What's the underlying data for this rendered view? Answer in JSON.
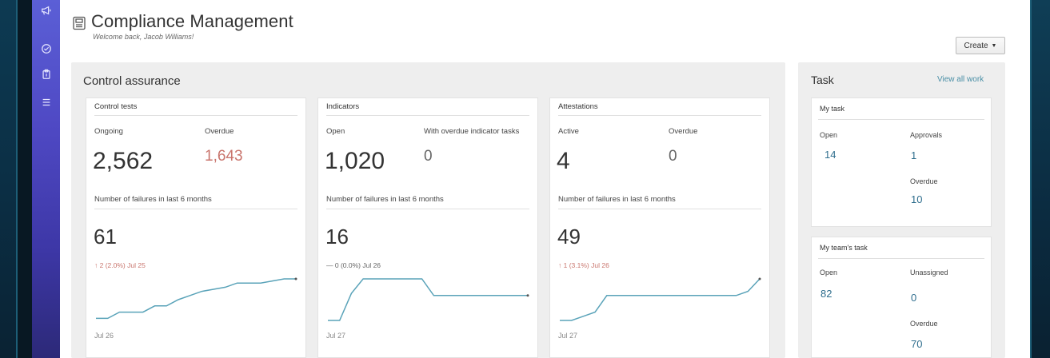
{
  "app": {
    "title": "Compliance Management",
    "welcome": "Welcome back, Jacob Williams!"
  },
  "sidebar": {
    "items": [
      {
        "icon": "megaphone-icon"
      },
      {
        "icon": "check-circle-icon"
      },
      {
        "icon": "clipboard-icon"
      },
      {
        "icon": "list-icon"
      }
    ]
  },
  "toolbar": {
    "create_label": "Create"
  },
  "control_assurance": {
    "title": "Control assurance",
    "control_tests": {
      "title": "Control tests",
      "ongoing_label": "Ongoing",
      "ongoing_value": "2,562",
      "overdue_label": "Overdue",
      "overdue_value": "1,643",
      "failures_label": "Number of failures in last 6 months",
      "failures_value": "61",
      "delta": "2 (2.0%) Jul 25",
      "sparkline": [
        0.05,
        0.05,
        0.2,
        0.2,
        0.2,
        0.35,
        0.35,
        0.5,
        0.6,
        0.7,
        0.75,
        0.8,
        0.9,
        0.9,
        0.9,
        0.95,
        1.0,
        1.0
      ],
      "date": "Jul 26"
    },
    "indicators": {
      "title": "Indicators",
      "open_label": "Open",
      "open_value": "1,020",
      "overdue_label": "With overdue indicator tasks",
      "overdue_value": "0",
      "failures_label": "Number of failures in last 6 months",
      "failures_value": "16",
      "delta": "— 0 (0.0%) Jul 26",
      "sparkline": [
        0.0,
        0.0,
        0.65,
        1.0,
        1.0,
        1.0,
        1.0,
        1.0,
        1.0,
        0.6,
        0.6,
        0.6,
        0.6,
        0.6,
        0.6,
        0.6,
        0.6,
        0.6
      ],
      "date": "Jul 27"
    },
    "attestations": {
      "title": "Attestations",
      "active_label": "Active",
      "active_value": "4",
      "overdue_label": "Overdue",
      "overdue_value": "0",
      "failures_label": "Number of failures in last 6 months",
      "failures_value": "49",
      "delta": "1 (3.1%) Jul 26",
      "sparkline": [
        0.0,
        0.0,
        0.1,
        0.2,
        0.6,
        0.6,
        0.6,
        0.6,
        0.6,
        0.6,
        0.6,
        0.6,
        0.6,
        0.6,
        0.6,
        0.6,
        0.7,
        1.0
      ],
      "date": "Jul 27"
    }
  },
  "task": {
    "title": "Task",
    "view_all": "View all work",
    "my_task": {
      "title": "My task",
      "open_label": "Open",
      "open_value": "14",
      "approvals_label": "Approvals",
      "approvals_value": "1",
      "overdue_label": "Overdue",
      "overdue_value": "10"
    },
    "team_task": {
      "title": "My team's task",
      "open_label": "Open",
      "open_value": "82",
      "unassigned_label": "Unassigned",
      "unassigned_value": "0",
      "overdue_label": "Overdue",
      "overdue_value": "70"
    }
  },
  "colors": {
    "sidebar": "#4f49c4",
    "accent_link": "#4a8fa6",
    "negative": "#c9756d",
    "sparkline": "#5aa3b9"
  }
}
